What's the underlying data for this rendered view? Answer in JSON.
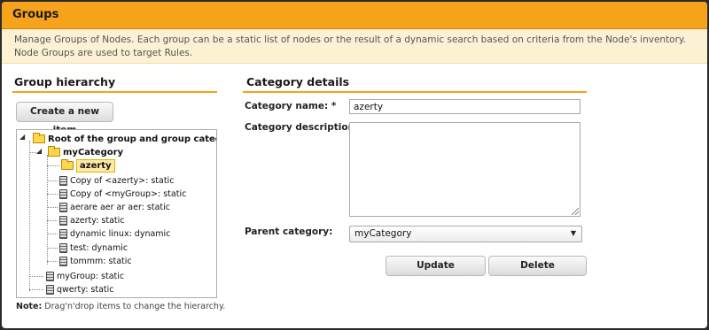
{
  "page": {
    "title": "Groups",
    "intro_line1": "Manage Groups of Nodes. Each group can be a static list of nodes or the result of a dynamic search based on criteria from the Node's inventory.",
    "intro_line2": "Node Groups are used to target Rules."
  },
  "hierarchy": {
    "title": "Group hierarchy",
    "create_button": "Create a new item",
    "tree": {
      "root": "Root of the group and group categories",
      "category": "myCategory",
      "selected_category": "azerty",
      "category_children": [
        "Copy of <azerty>: static",
        "Copy of <myGroup>: static",
        "aerare aer ar aer: static",
        "azerty: static",
        "dynamic linux: dynamic",
        "test: dynamic",
        "tommm: static"
      ],
      "root_children": [
        "myGroup: static",
        "qwerty: static"
      ]
    },
    "note_label": "Note:",
    "note_text": " Drag'n'drop items to change the hierarchy."
  },
  "details": {
    "title": "Category details",
    "name_label": "Category name: *",
    "name_value": "azerty",
    "description_label": "Category description:",
    "description_value": "",
    "parent_label": "Parent category:",
    "parent_value": "myCategory",
    "update_button": "Update",
    "delete_button": "Delete"
  },
  "colors": {
    "accent": "#f7a21b",
    "intro_background": "#fdf1d4",
    "selection": "#ffe9a6"
  }
}
